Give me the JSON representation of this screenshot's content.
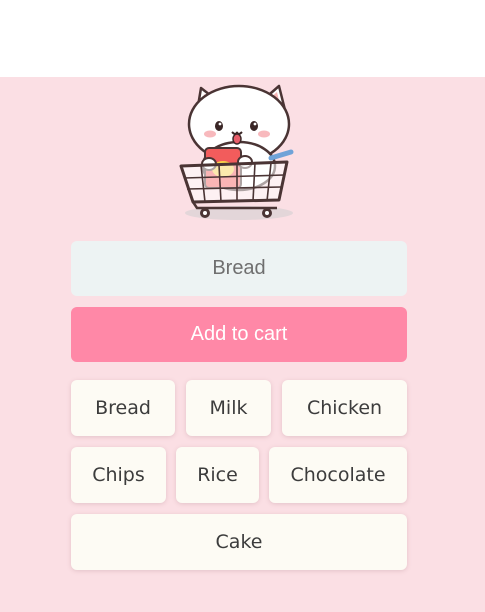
{
  "mascot": {
    "icon": "cat-in-shopping-cart-icon"
  },
  "input": {
    "value": "",
    "placeholder": "Bread"
  },
  "add_button": {
    "label": "Add to cart"
  },
  "chips": [
    {
      "label": "Bread"
    },
    {
      "label": "Milk"
    },
    {
      "label": "Chicken"
    },
    {
      "label": "Chips"
    },
    {
      "label": "Rice"
    },
    {
      "label": "Chocolate"
    },
    {
      "label": "Cake"
    }
  ],
  "colors": {
    "page_background": "#fbdfe4",
    "input_background": "#edf3f3",
    "button": "#ff88a7",
    "chip_background": "#fdfbf4"
  }
}
